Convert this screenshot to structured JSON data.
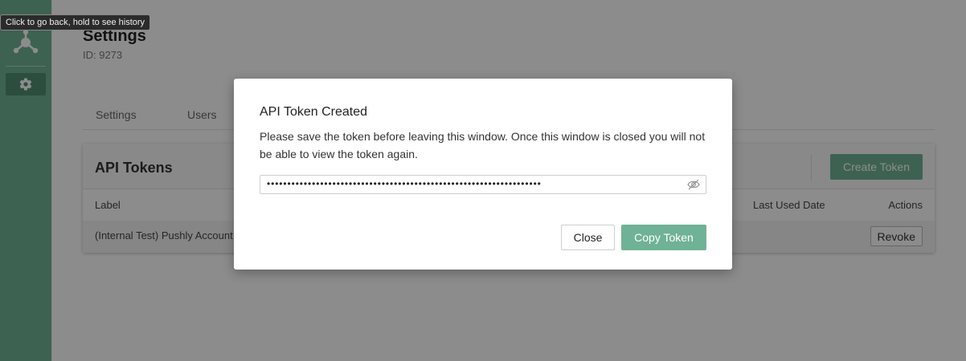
{
  "tooltip": {
    "text": "Click to go back, hold to see history"
  },
  "sidebar": {
    "logo_icon": "network-hub-icon",
    "items": [
      {
        "icon": "gear-icon",
        "label": "",
        "active": true
      }
    ]
  },
  "page": {
    "title": "Settings",
    "id_text": "ID: 9273"
  },
  "tabs": [
    {
      "label": "Settings"
    },
    {
      "label": "Users"
    }
  ],
  "api_tokens": {
    "title": "API Tokens",
    "create_button": "Create Token",
    "columns": {
      "label": "Label",
      "last_used": "Last Used Date",
      "actions": "Actions"
    },
    "rows": [
      {
        "label": "(Internal Test) Pushly Account",
        "last_used": "",
        "action": "Revoke"
      }
    ]
  },
  "modal": {
    "title": "API Token Created",
    "message": "Please save the token before leaving this window. Once this window is closed you will not be able to view the token again.",
    "token_masked": "•••••••••••••••••••••••••••••••••••••••••••••••••••••••••••••••••••",
    "reveal_icon": "eye-slash-icon",
    "close_button": "Close",
    "copy_button": "Copy Token"
  },
  "colors": {
    "brand_green": "#6fb296",
    "sidebar_active": "#4f8f73"
  }
}
